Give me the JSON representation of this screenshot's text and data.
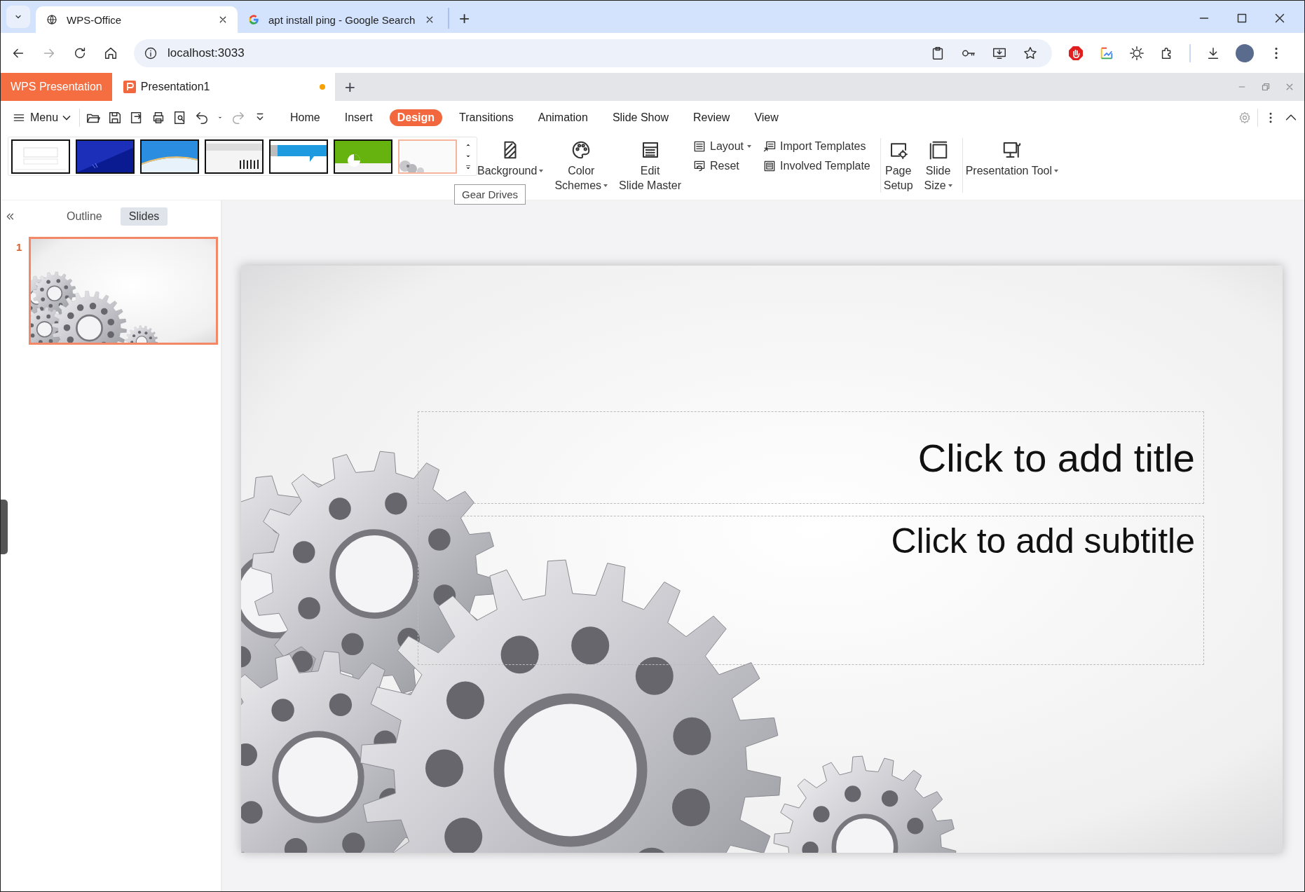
{
  "browser": {
    "tabs": [
      {
        "title": "WPS-Office",
        "selected": true
      },
      {
        "title": "apt install ping - Google Search",
        "selected": false
      }
    ],
    "new_tab": "+",
    "address": "localhost:3033"
  },
  "app_tabs": {
    "brand": "WPS Presentation",
    "documents": [
      {
        "title": "Presentation1",
        "unsaved": true,
        "selected": true
      }
    ],
    "new_tab": "+"
  },
  "menu": "Menu",
  "ribbon_tabs": [
    {
      "label": "Home",
      "selected": false
    },
    {
      "label": "Insert",
      "selected": false
    },
    {
      "label": "Design",
      "selected": true
    },
    {
      "label": "Transitions",
      "selected": false
    },
    {
      "label": "Animation",
      "selected": false
    },
    {
      "label": "Slide Show",
      "selected": false
    },
    {
      "label": "Review",
      "selected": false
    },
    {
      "label": "View",
      "selected": false
    }
  ],
  "theme_gallery": [
    {
      "kind": "plain",
      "selected": false
    },
    {
      "kind": "blue-diagonal",
      "selected": false
    },
    {
      "kind": "blue-wave",
      "selected": false
    },
    {
      "kind": "people",
      "selected": false
    },
    {
      "kind": "blue-banner",
      "selected": false
    },
    {
      "kind": "green-pie",
      "selected": false
    },
    {
      "kind": "gears",
      "selected": true
    }
  ],
  "tooltip": "Gear Drives",
  "ribbon_groups": [
    [
      {
        "kind": "large",
        "label": "Background",
        "dropdown": true
      },
      {
        "kind": "large",
        "label": "Color\nSchemes",
        "dropdown": true
      },
      {
        "kind": "large",
        "label": "Edit\nSlide Master",
        "dropdown": false
      },
      {
        "kind": "stack",
        "items": [
          {
            "label": "Layout",
            "dropdown": true
          },
          {
            "label": "Reset",
            "dropdown": false
          }
        ]
      },
      {
        "kind": "stack",
        "items": [
          {
            "label": "Import Templates",
            "dropdown": false
          },
          {
            "label": "Involved Template",
            "dropdown": false
          }
        ]
      }
    ],
    [
      {
        "kind": "large",
        "label": "Page\nSetup",
        "dropdown": false
      },
      {
        "kind": "large",
        "label": "Slide\nSize",
        "dropdown": true
      }
    ],
    [
      {
        "kind": "large",
        "label": "Presentation Tool",
        "dropdown": true
      }
    ]
  ],
  "panel_tabs": [
    {
      "label": "Outline",
      "selected": false
    },
    {
      "label": "Slides",
      "selected": true
    }
  ],
  "slides": [
    {
      "number": "1",
      "selected": true
    }
  ],
  "slide": {
    "title": "Click to add title",
    "subtitle": "Click to add subtitle"
  }
}
